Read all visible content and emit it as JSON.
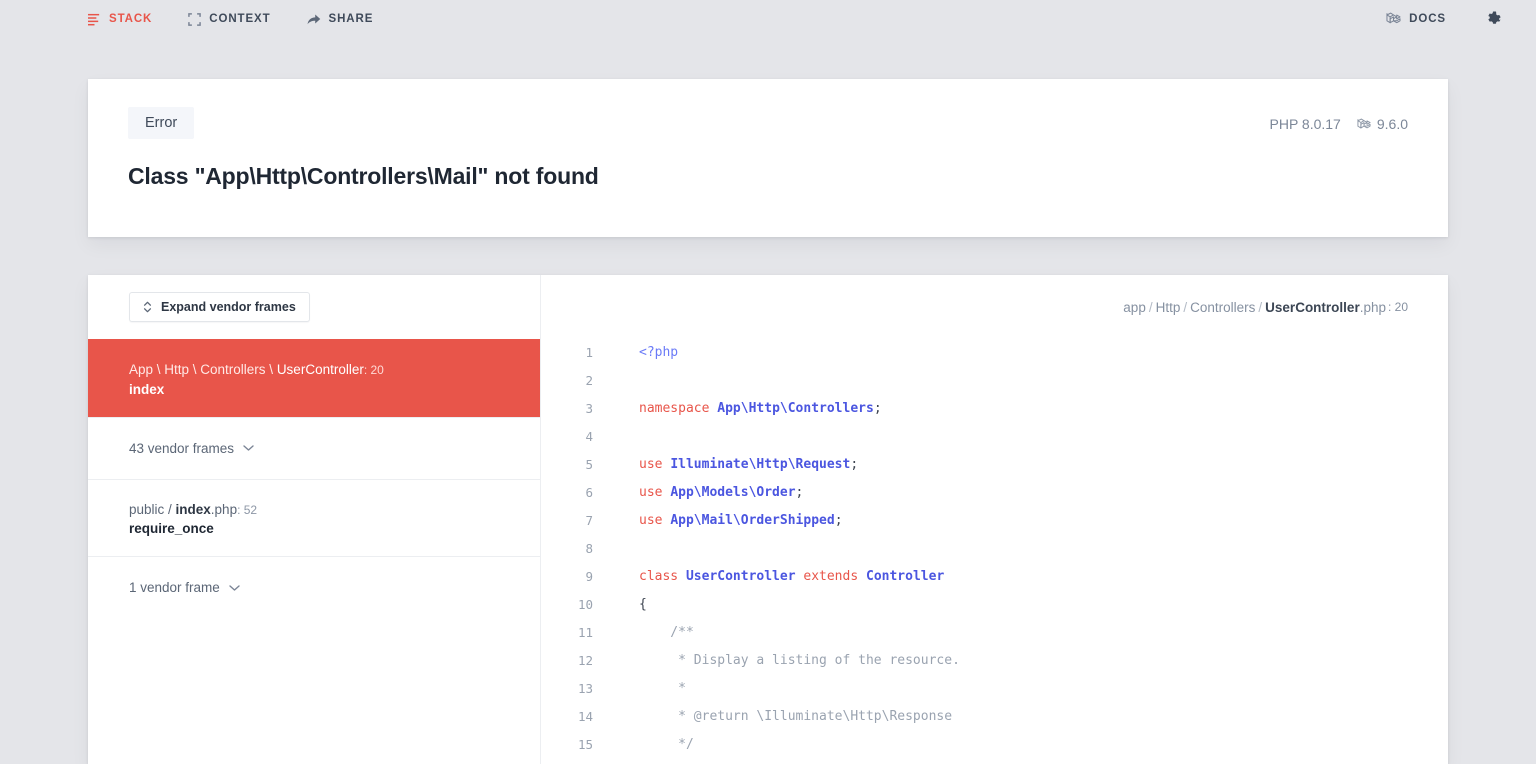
{
  "topbar": {
    "nav": [
      {
        "id": "stack",
        "label": "STACK",
        "icon": "stack-icon",
        "active": true
      },
      {
        "id": "context",
        "label": "CONTEXT",
        "icon": "context-icon",
        "active": false
      },
      {
        "id": "share",
        "label": "SHARE",
        "icon": "share-icon",
        "active": false
      }
    ],
    "docs_label": "DOCS",
    "docs_icon": "laravel-logo-icon",
    "settings_icon": "gear-icon"
  },
  "error": {
    "badge": "Error",
    "title": "Class \"App\\Http\\Controllers\\Mail\" not found",
    "php_version": "PHP 8.0.17",
    "laravel_version": "9.6.0",
    "laravel_icon": "laravel-logo-icon"
  },
  "frames_pane": {
    "expand_button": "Expand vendor frames",
    "expand_icon": "expand-vertical-icon",
    "frames": [
      {
        "type": "frame",
        "active": true,
        "path_plain": "App \\ Http \\ Controllers \\ ",
        "path_strong": "UserController",
        "path_suffix": "",
        "line": ": 20",
        "method": "index"
      },
      {
        "type": "vendor-group",
        "label": "43 vendor frames",
        "icon": "chevron-down-icon"
      },
      {
        "type": "frame",
        "active": false,
        "path_plain": "public / ",
        "path_strong": "index",
        "path_suffix": ".php",
        "line": ": 52",
        "method": "require_once"
      },
      {
        "type": "vendor-group",
        "label": "1 vendor frame",
        "icon": "chevron-down-icon"
      }
    ]
  },
  "code_pane": {
    "file_path": {
      "segments": [
        "app",
        "Http",
        "Controllers"
      ],
      "file_strong": "UserController",
      "file_ext": ".php",
      "line": ": 20"
    },
    "lines": [
      {
        "n": "1",
        "tokens": [
          {
            "t": "<?php",
            "c": "t-tag"
          }
        ]
      },
      {
        "n": "2",
        "tokens": []
      },
      {
        "n": "3",
        "tokens": [
          {
            "t": "namespace ",
            "c": "t-kw"
          },
          {
            "t": "App\\Http\\Controllers",
            "c": "t-cls"
          },
          {
            "t": ";",
            "c": "t-pun"
          }
        ]
      },
      {
        "n": "4",
        "tokens": []
      },
      {
        "n": "5",
        "tokens": [
          {
            "t": "use ",
            "c": "t-kw"
          },
          {
            "t": "Illuminate\\Http\\Request",
            "c": "t-cls"
          },
          {
            "t": ";",
            "c": "t-pun"
          }
        ]
      },
      {
        "n": "6",
        "tokens": [
          {
            "t": "use ",
            "c": "t-kw"
          },
          {
            "t": "App\\Models\\Order",
            "c": "t-cls"
          },
          {
            "t": ";",
            "c": "t-pun"
          }
        ]
      },
      {
        "n": "7",
        "tokens": [
          {
            "t": "use ",
            "c": "t-kw"
          },
          {
            "t": "App\\Mail\\OrderShipped",
            "c": "t-cls"
          },
          {
            "t": ";",
            "c": "t-pun"
          }
        ]
      },
      {
        "n": "8",
        "tokens": []
      },
      {
        "n": "9",
        "tokens": [
          {
            "t": "class ",
            "c": "t-kw"
          },
          {
            "t": "UserController",
            "c": "t-cls"
          },
          {
            "t": " extends ",
            "c": "t-kw"
          },
          {
            "t": "Controller",
            "c": "t-cls"
          }
        ]
      },
      {
        "n": "10",
        "tokens": [
          {
            "t": "{",
            "c": "t-pun"
          }
        ]
      },
      {
        "n": "11",
        "tokens": [
          {
            "t": "    /**",
            "c": "t-com"
          }
        ]
      },
      {
        "n": "12",
        "tokens": [
          {
            "t": "     * Display a listing of the resource.",
            "c": "t-com"
          }
        ]
      },
      {
        "n": "13",
        "tokens": [
          {
            "t": "     *",
            "c": "t-com"
          }
        ]
      },
      {
        "n": "14",
        "tokens": [
          {
            "t": "     * @return \\Illuminate\\Http\\Response",
            "c": "t-com"
          }
        ]
      },
      {
        "n": "15",
        "tokens": [
          {
            "t": "     */",
            "c": "t-com"
          }
        ]
      }
    ]
  },
  "colors": {
    "accent_red": "#e8554a",
    "page_bg": "#e4e5e9",
    "card_bg": "#ffffff",
    "keyword": "#e8554a",
    "class_name": "#4b56e0",
    "comment": "#9aa3b0"
  }
}
